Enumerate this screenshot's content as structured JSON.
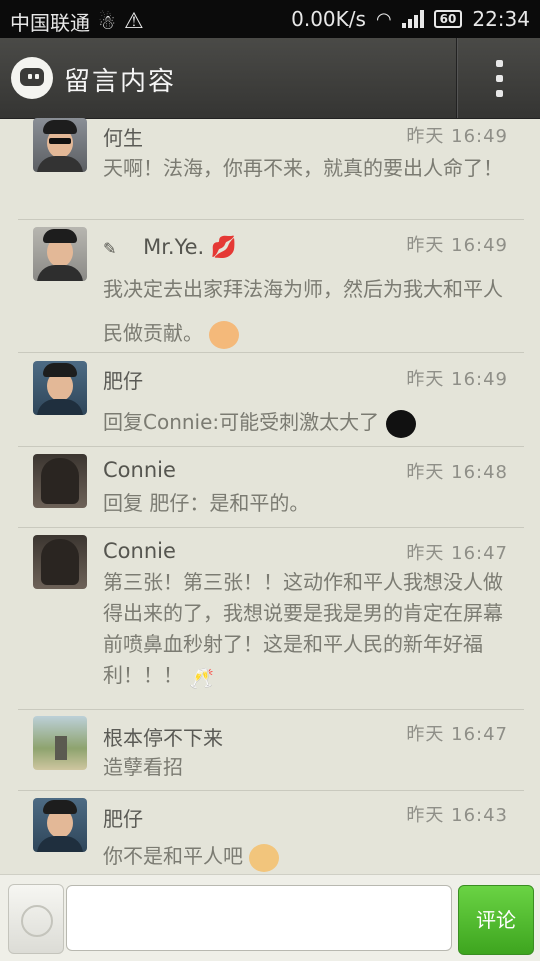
{
  "status_bar": {
    "carrier": "中国联通",
    "network_speed": "0.00K/s",
    "battery": "60",
    "time": "22:34"
  },
  "header": {
    "title": "留言内容"
  },
  "comments": [
    {
      "author": "何生",
      "time": "昨天 16:49",
      "text": "天啊！法海，你再不来，就真的要出人命了！"
    },
    {
      "author": "Mr.Ye.",
      "time": "昨天 16:49",
      "text": "我决定去出家拜法海为师，然后为我大和平人民做贡献。"
    },
    {
      "author": "肥仔",
      "time": "昨天 16:49",
      "text": "回复Connie:可能受刺激太大了"
    },
    {
      "author": "Connie",
      "time": "昨天 16:48",
      "text": "回复 肥仔：是和平的。"
    },
    {
      "author": "Connie",
      "time": "昨天 16:47",
      "text": "第三张！第三张！！这动作和平人我想没人做得出来的了，我想说要是我是男的肯定在屏幕前喷鼻血秒射了！这是和平人民的新年好福利！！！"
    },
    {
      "author": "根本停不下来",
      "time": "昨天 16:47",
      "text": "造孽看招"
    },
    {
      "author": "肥仔",
      "time": "昨天 16:43",
      "text": "你不是和平人吧"
    }
  ],
  "input_bar": {
    "placeholder": "",
    "submit_label": "评论"
  },
  "colors": {
    "background": "#e4e4d9",
    "header": "#3f3f3d",
    "submit": "#4fbf2c",
    "name_text": "#5a5a55",
    "body_text": "#7b7b72"
  }
}
